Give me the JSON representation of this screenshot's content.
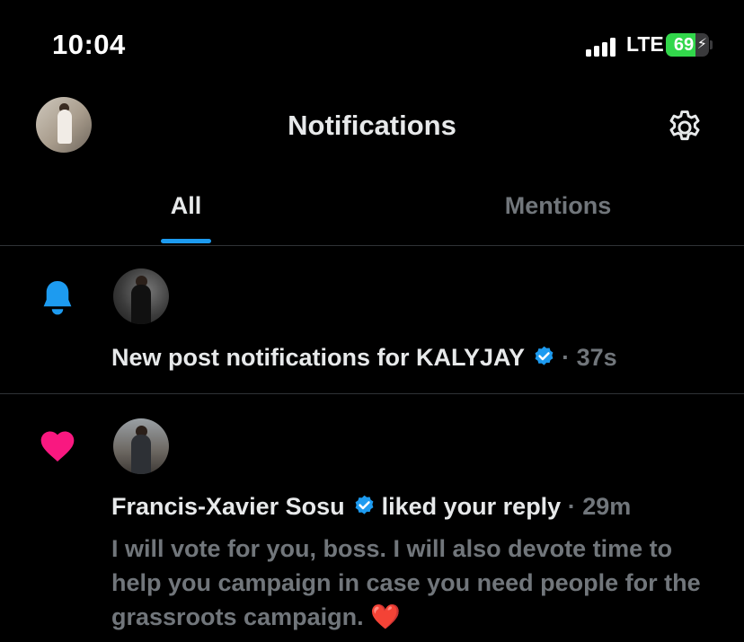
{
  "status_bar": {
    "time": "10:04",
    "network": "LTE",
    "battery": "69",
    "battery_level": 0.69,
    "battery_color": "#32d74b"
  },
  "header": {
    "title": "Notifications",
    "avatar_icon": "user-avatar",
    "settings_icon": "gear-icon"
  },
  "tabs": [
    {
      "label": "All",
      "active": true
    },
    {
      "label": "Mentions",
      "active": false
    }
  ],
  "accent_color": "#1d9bf0",
  "notifications": [
    {
      "type": "new-post",
      "icon": "bell-icon",
      "icon_color": "#1d9bf0",
      "text": "New post notifications for KALYJAY",
      "verified": true,
      "time": "· 37s"
    },
    {
      "type": "like",
      "icon": "heart-icon",
      "icon_color": "#f91880",
      "user": "Francis-Xavier Sosu",
      "verified": true,
      "action": "liked your reply",
      "time": "· 29m",
      "content": "I will vote for you, boss. I will also devote time to help you campaign in case you need people for the grassroots campaign.",
      "content_emoji": "❤️"
    }
  ]
}
